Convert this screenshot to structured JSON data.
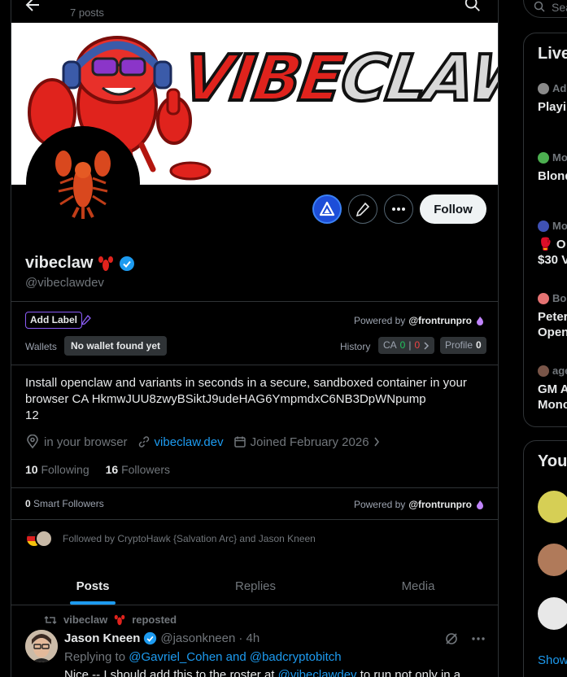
{
  "header": {
    "posts_count": "7 posts"
  },
  "banner": {
    "text_a": "VIBE",
    "text_b": "CLAW"
  },
  "profile": {
    "display_name": "vibeclaw",
    "handle": "@vibeclawdev",
    "follow_label": "Follow"
  },
  "wallet_panel": {
    "add_label": "Add Label",
    "powered_by_prefix": "Powered by",
    "powered_by_brand": "@frontrunpro",
    "wallets_label": "Wallets",
    "no_wallet": "No wallet found yet",
    "history_label": "History",
    "ca_label": "CA",
    "ca_green": "0",
    "ca_sep": "|",
    "ca_red": "0",
    "profile_label": "Profile",
    "profile_count": "0"
  },
  "bio": {
    "line1": "Install openclaw and variants in seconds in a secure, sandboxed container in your",
    "line2": "browser CA HkmwJUU8zwyBSiktJ9udeHAG6YmpmdxC6NB3DpWNpump",
    "line3": "12"
  },
  "meta": {
    "location": "in your browser",
    "website": "vibeclaw.dev",
    "joined": "Joined February 2026"
  },
  "stats": {
    "following_count": "10",
    "following_label": "Following",
    "followers_count": "16",
    "followers_label": "Followers"
  },
  "smart": {
    "count": "0",
    "label": "Smart Followers",
    "powered_by_prefix": "Powered by",
    "powered_by_brand": "@frontrunpro"
  },
  "followed_by": "Followed by CryptoHawk {Salvation Arc} and Jason Kneen",
  "tabs": [
    {
      "label": "Posts"
    },
    {
      "label": "Replies"
    },
    {
      "label": "Media"
    }
  ],
  "post": {
    "repost_by": "vibeclaw",
    "repost_label": "reposted",
    "author_name": "Jason Kneen",
    "author_handle": "@jasonkneen",
    "time": "· 4h",
    "replying_prefix": "Replying to",
    "replying_to": "@Gavriel_Cohen and @badcryptobitch",
    "text_a": "Nice -- I should add this to the roster at ",
    "text_link": "@vibeclawdev",
    "text_b": " to run not only in a"
  },
  "right_column": {
    "search_placeholder": "Sea",
    "live_title": "Live",
    "live_items": [
      {
        "meta": "Ad",
        "text": "Playi"
      },
      {
        "meta": "Mo",
        "text": "Blond"
      },
      {
        "meta": "Mo",
        "text": "🥊 O",
        "text2": "$30 V"
      },
      {
        "meta": "Bo",
        "text": "Peter",
        "text2": "Open"
      },
      {
        "meta": "age",
        "text": "GM A",
        "text2": "Monc"
      }
    ],
    "you_title": "You",
    "show_more": "Show"
  },
  "colors": {
    "accent": "#1d9bf0",
    "background": "#000000",
    "border": "#2f3336",
    "muted": "#71767b",
    "frontrun_purple": "#8b5cf6"
  }
}
